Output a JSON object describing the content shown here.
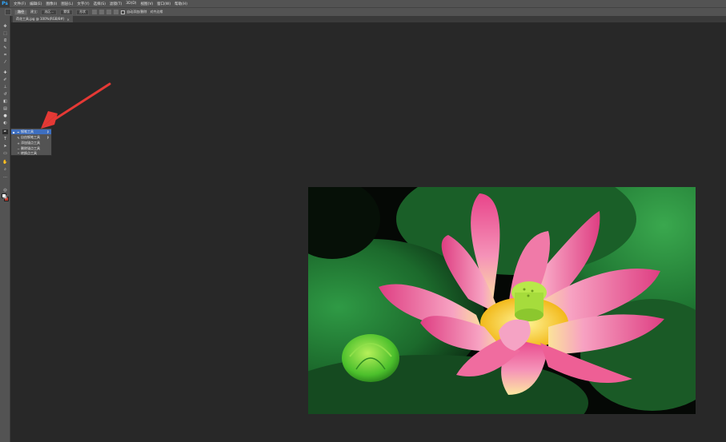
{
  "app": {
    "logo": "Ps"
  },
  "menubar": {
    "items": [
      "文件(F)",
      "编辑(E)",
      "图像(I)",
      "图层(L)",
      "文字(Y)",
      "选择(S)",
      "滤镜(T)",
      "3D(D)",
      "视图(V)",
      "窗口(W)",
      "帮助(H)"
    ]
  },
  "options": {
    "mode_label": "路径",
    "make_label": "建立:",
    "selection_btn": "选区...",
    "mask_btn": "蒙版",
    "shape_btn": "形状",
    "auto_label": "自动添加/删除",
    "align_label": "对齐边缘"
  },
  "document": {
    "tab_label": "荷花工具.jpg @ 100%(RGB/8#)"
  },
  "flyout": {
    "items": [
      {
        "label": "钢笔工具",
        "shortcut": "P",
        "selected": true
      },
      {
        "label": "自由钢笔工具",
        "shortcut": "P",
        "selected": false
      },
      {
        "label": "添加锚点工具",
        "shortcut": "",
        "selected": false
      },
      {
        "label": "删除锚点工具",
        "shortcut": "",
        "selected": false
      },
      {
        "label": "转换点工具",
        "shortcut": "",
        "selected": false
      }
    ]
  },
  "colors": {
    "ui_panel": "#535353",
    "workspace": "#282828",
    "selection_blue": "#3e6fc0",
    "arrow_red": "#e53935",
    "foreground_swatch": "#ffffff",
    "background_swatch": "#c0392b"
  },
  "icons": {
    "tools": [
      "move-icon",
      "marquee-icon",
      "lasso-icon",
      "quick-select-icon",
      "crop-icon",
      "eyedropper-icon",
      "healing-brush-icon",
      "brush-icon",
      "clone-stamp-icon",
      "history-brush-icon",
      "eraser-icon",
      "gradient-icon",
      "blur-icon",
      "dodge-icon",
      "pen-icon",
      "type-icon",
      "path-select-icon",
      "shape-icon",
      "hand-icon",
      "zoom-icon"
    ]
  }
}
